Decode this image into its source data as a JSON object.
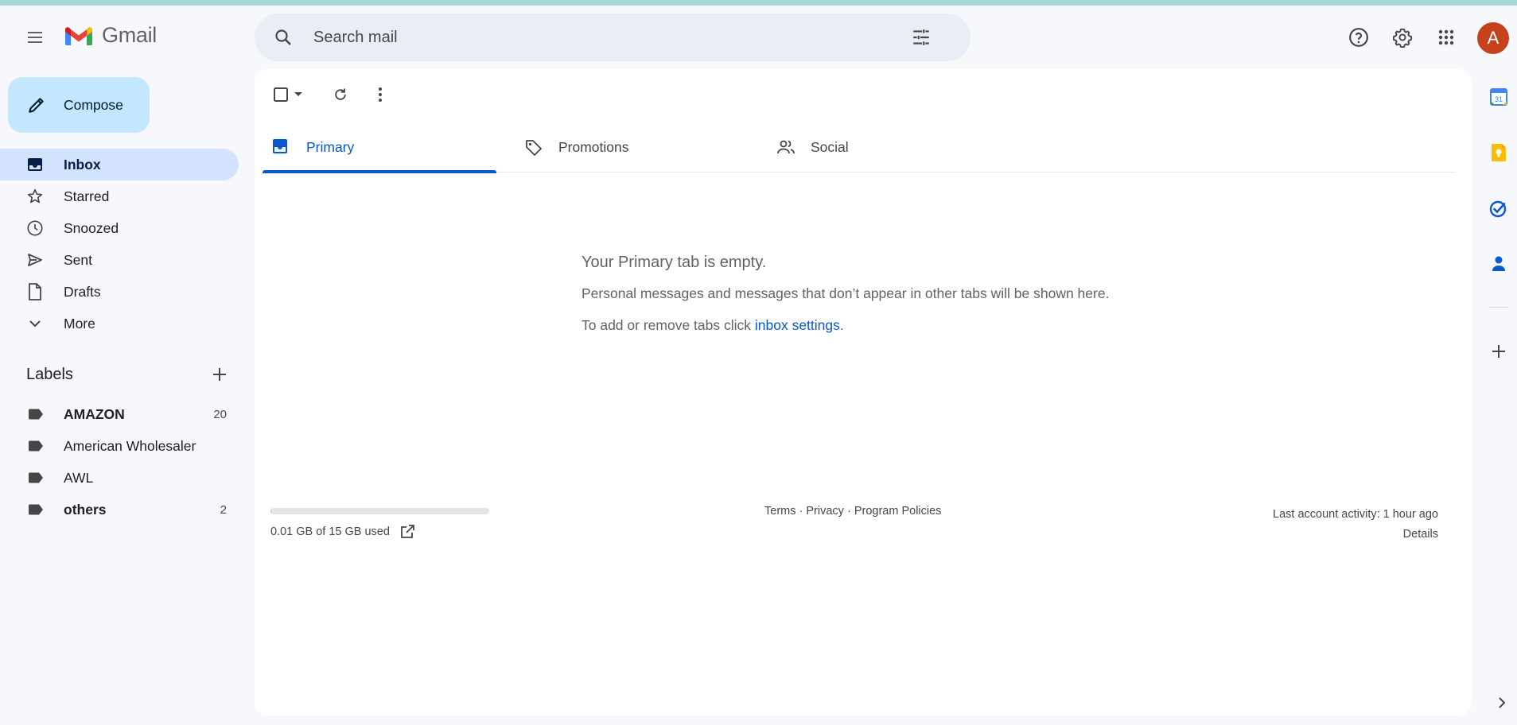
{
  "app": {
    "name": "Gmail"
  },
  "header": {
    "search_placeholder": "Search mail",
    "avatar_letter": "A",
    "avatar_color": "#c5421c"
  },
  "compose": {
    "label": "Compose"
  },
  "nav": {
    "items": [
      {
        "label": "Inbox",
        "icon": "inbox-icon",
        "active": true
      },
      {
        "label": "Starred",
        "icon": "star-icon"
      },
      {
        "label": "Snoozed",
        "icon": "clock-icon"
      },
      {
        "label": "Sent",
        "icon": "send-icon"
      },
      {
        "label": "Drafts",
        "icon": "draft-icon"
      },
      {
        "label": "More",
        "icon": "chevron-down-icon"
      }
    ]
  },
  "labels": {
    "heading": "Labels",
    "items": [
      {
        "name": "AMAZON",
        "count": "20",
        "bold": true
      },
      {
        "name": "American Wholesaler",
        "count": ""
      },
      {
        "name": "AWL",
        "count": ""
      },
      {
        "name": "others",
        "count": "2",
        "bold": true
      }
    ]
  },
  "tabs": [
    {
      "label": "Primary",
      "icon": "inbox-tab-icon",
      "active": true
    },
    {
      "label": "Promotions",
      "icon": "tag-icon"
    },
    {
      "label": "Social",
      "icon": "people-icon"
    }
  ],
  "empty_state": {
    "title": "Your Primary tab is empty.",
    "message": "Personal messages and messages that don’t appear in other tabs will be shown here.",
    "settings_prefix": "To add or remove tabs click ",
    "settings_link": "inbox settings",
    "settings_suffix": "."
  },
  "footer": {
    "storage_text": "0.01 GB of 15 GB used",
    "storage_used_fraction": 0.0007,
    "terms": "Terms",
    "privacy": "Privacy",
    "policies": "Program Policies",
    "separator": "·",
    "last_activity": "Last account activity: 1 hour ago",
    "details": "Details"
  },
  "side_panel": {
    "apps": [
      "calendar-icon",
      "keep-icon",
      "tasks-icon",
      "contacts-icon"
    ]
  },
  "colors": {
    "accent": "#0b57d0",
    "compose_bg": "#c2e7ff",
    "active_nav_bg": "#d3e3fd"
  }
}
